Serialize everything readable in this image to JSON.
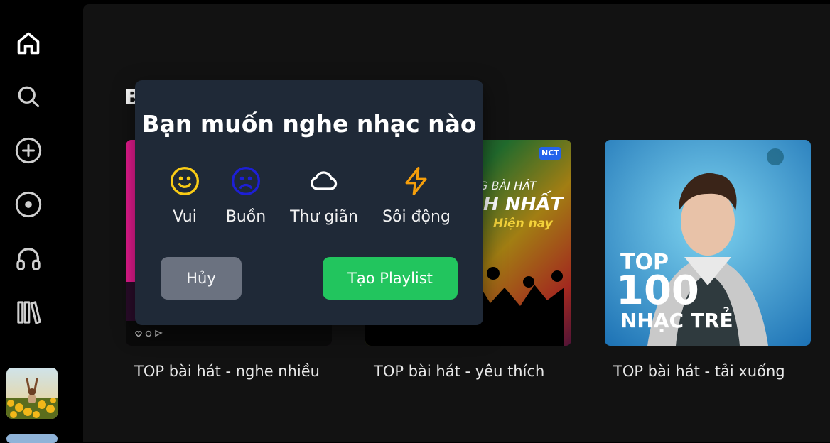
{
  "nav": {
    "items": [
      {
        "icon": "home-icon"
      },
      {
        "icon": "search-icon"
      },
      {
        "icon": "add-circle-icon"
      },
      {
        "icon": "disc-icon"
      },
      {
        "icon": "headphones-icon"
      },
      {
        "icon": "library-icon"
      }
    ]
  },
  "main": {
    "section_heading": "B",
    "cards": [
      {
        "title": "TOP bài hát - nghe nhiều"
      },
      {
        "title": "TOP bài hát - yêu thích",
        "art_text_1": "G BÀI HÁT",
        "art_text_2": "H NHẤT",
        "art_text_3": "Hiện nay",
        "badge": "NCT"
      },
      {
        "title": "TOP bài hát - tải xuống",
        "art_text_1": "TOP",
        "art_text_2": "100",
        "art_text_3": "NHẠC TRẺ"
      }
    ]
  },
  "modal": {
    "title": "Bạn muốn nghe nhạc nào",
    "moods": [
      {
        "label": "Vui",
        "icon": "smile-icon",
        "color": "#facc15"
      },
      {
        "label": "Buồn",
        "icon": "frown-icon",
        "color": "#1d1fd6"
      },
      {
        "label": "Thư giãn",
        "icon": "cloud-icon",
        "color": "#ffffff"
      },
      {
        "label": "Sôi động",
        "icon": "lightning-icon",
        "color": "#f59e0b"
      }
    ],
    "cancel_label": "Hủy",
    "create_label": "Tạo Playlist"
  },
  "colors": {
    "accent": "#22c55e",
    "modal_bg": "#1f2937",
    "cancel_bg": "#6b7280"
  }
}
